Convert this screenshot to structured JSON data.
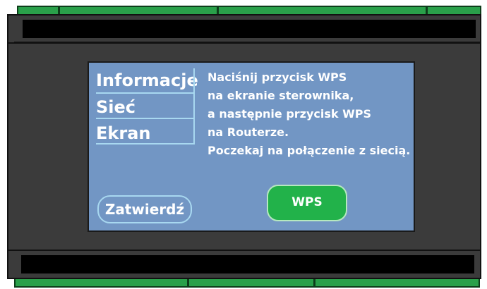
{
  "menu": {
    "items": [
      "Informacje",
      "Sieć",
      "Ekran"
    ]
  },
  "message": {
    "lines": [
      "Naciśnij przycisk WPS",
      "na ekranie sterownika,",
      "a następnie przycisk WPS",
      "na Routerze.",
      "Poczekaj na połączenie z siecią."
    ]
  },
  "buttons": {
    "confirm": "Zatwierdź",
    "wps": "WPS"
  },
  "colors": {
    "screen": "#7296c4",
    "wps_button": "#22b24a",
    "device_body": "#3b3b3b",
    "terminal": "#2aa04a",
    "menu_divider": "#a8d8f0"
  }
}
